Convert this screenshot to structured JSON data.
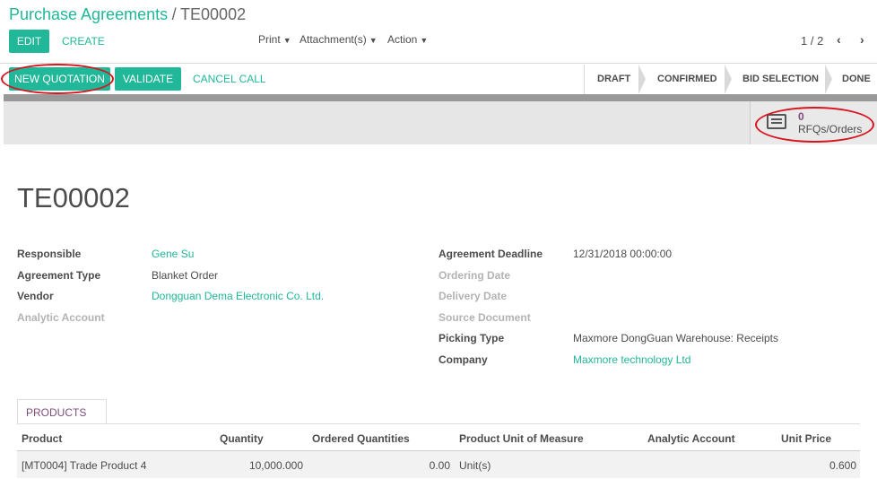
{
  "breadcrumb": {
    "parent": "Purchase Agreements",
    "separator": "/",
    "current": "TE00002"
  },
  "toolbar": {
    "edit_label": "EDIT",
    "create_label": "CREATE",
    "print_label": "Print",
    "attachments_label": "Attachment(s)",
    "action_label": "Action",
    "pager": "1 / 2",
    "prev_icon": "chevron-left-icon",
    "next_icon": "chevron-right-icon"
  },
  "header_buttons": {
    "new_quotation": "NEW QUOTATION",
    "validate": "VALIDATE",
    "cancel_call": "CANCEL CALL"
  },
  "statusbar": [
    "DRAFT",
    "CONFIRMED",
    "BID SELECTION",
    "DONE"
  ],
  "statusbar_active": "CONFIRMED",
  "smart_button": {
    "count": "0",
    "label": "RFQs/Orders",
    "icon": "list-icon"
  },
  "record": {
    "title": "TE00002",
    "left_fields": [
      {
        "label": "Responsible",
        "value": "Gene Su",
        "link": true
      },
      {
        "label": "Agreement Type",
        "value": "Blanket Order",
        "link": false
      },
      {
        "label": "Vendor",
        "value": "Dongguan Dema Electronic Co. Ltd.",
        "link": true
      },
      {
        "label": "Analytic Account",
        "value": "",
        "link": false
      }
    ],
    "right_fields": [
      {
        "label": "Agreement Deadline",
        "value": "12/31/2018 00:00:00",
        "link": false
      },
      {
        "label": "Ordering Date",
        "value": "",
        "link": false
      },
      {
        "label": "Delivery Date",
        "value": "",
        "link": false
      },
      {
        "label": "Source Document",
        "value": "",
        "link": false
      },
      {
        "label": "Picking Type",
        "value": "Maxmore DongGuan Warehouse: Receipts",
        "link": false
      },
      {
        "label": "Company",
        "value": "Maxmore technology Ltd",
        "link": true
      }
    ]
  },
  "products_tab": "PRODUCTS",
  "table": {
    "headers": [
      "Product",
      "Quantity",
      "Ordered Quantities",
      "Product Unit of Measure",
      "Analytic Account",
      "Unit Price"
    ],
    "rows": [
      [
        "[MT0004] Trade Product 4",
        "10,000.000",
        "0.00",
        "Unit(s)",
        "",
        "0.600"
      ]
    ]
  },
  "colors": {
    "accent": "#21b799",
    "annotation": "#d8141e",
    "muted": "#b3b3b3",
    "tab": "#7c4d7a"
  }
}
